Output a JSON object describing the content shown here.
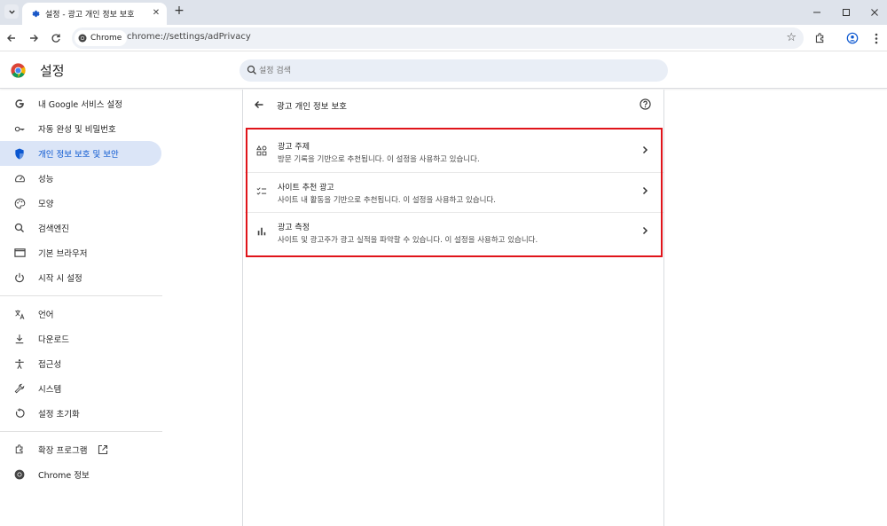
{
  "tab": {
    "title": "설정 - 광고 개인 정보 보호",
    "close": "✕"
  },
  "toolbar": {
    "chip_label": "Chrome",
    "url": "chrome://settings/adPrivacy"
  },
  "header": {
    "title": "설정",
    "search_placeholder": "설정 검색"
  },
  "sidebar": {
    "items": [
      {
        "label": "내 Google 서비스 설정",
        "icon": "google-g-icon"
      },
      {
        "label": "자동 완성 및 비밀번호",
        "icon": "key-icon"
      },
      {
        "label": "개인 정보 보호 및 보안",
        "icon": "shield-icon",
        "active": true
      },
      {
        "label": "성능",
        "icon": "speedometer-icon"
      },
      {
        "label": "모양",
        "icon": "palette-icon"
      },
      {
        "label": "검색엔진",
        "icon": "search-icon"
      },
      {
        "label": "기본 브라우저",
        "icon": "browser-window-icon"
      },
      {
        "label": "시작 시 설정",
        "icon": "power-icon"
      },
      {
        "label": "언어",
        "icon": "translate-icon"
      },
      {
        "label": "다운로드",
        "icon": "download-icon"
      },
      {
        "label": "접근성",
        "icon": "accessibility-icon"
      },
      {
        "label": "시스템",
        "icon": "wrench-icon"
      },
      {
        "label": "설정 초기화",
        "icon": "reset-icon"
      },
      {
        "label": "확장 프로그램",
        "icon": "puzzle-icon"
      },
      {
        "label": "Chrome 정보",
        "icon": "chrome-logo-icon"
      }
    ]
  },
  "main": {
    "title": "광고 개인 정보 보호",
    "rows": [
      {
        "title": "광고 주제",
        "desc": "방문 기록을 기반으로 추천됩니다. 이 설정을 사용하고 있습니다."
      },
      {
        "title": "사이트 추천 광고",
        "desc": "사이트 내 활동을 기반으로 추천됩니다. 이 설정을 사용하고 있습니다."
      },
      {
        "title": "광고 측정",
        "desc": "사이트 및 광고주가 광고 실적을 파악할 수 있습니다. 이 설정을 사용하고 있습니다."
      }
    ]
  },
  "colors": {
    "accent": "#0b57d0",
    "active_bg": "#dbe5f7",
    "highlight_border": "#e0141a"
  }
}
